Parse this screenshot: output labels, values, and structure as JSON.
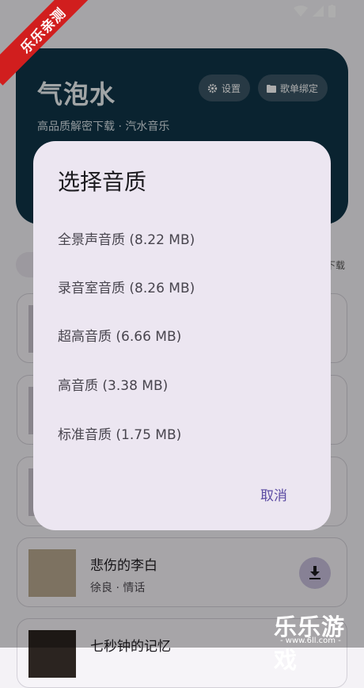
{
  "header": {
    "title": "气泡水",
    "subtitle": "高品质解密下载 · 汽水音乐",
    "settings_label": "设置",
    "bind_label": "歌单绑定"
  },
  "toolbar": {
    "right_label": "下载"
  },
  "songs": [
    {
      "title": "悲伤的李白",
      "subtitle": "徐良 · 情话"
    },
    {
      "title": "七秒钟的记忆",
      "subtitle": ""
    }
  ],
  "dialog": {
    "title": "选择音质",
    "options": [
      "全景声音质 (8.22 MB)",
      "录音室音质 (8.26 MB)",
      "超高音质 (6.66 MB)",
      "高音质 (3.38 MB)",
      "标准音质 (1.75 MB)"
    ],
    "cancel_label": "取消"
  },
  "watermark": {
    "ribbon": "乐乐亲测",
    "brand": "乐乐游戏",
    "url": "- www.6ll.com -"
  },
  "colors": {
    "header_bg": "#0f3447",
    "dialog_bg": "#ece6f1",
    "accent": "#5b4ba3",
    "ribbon": "#d11e1e"
  }
}
